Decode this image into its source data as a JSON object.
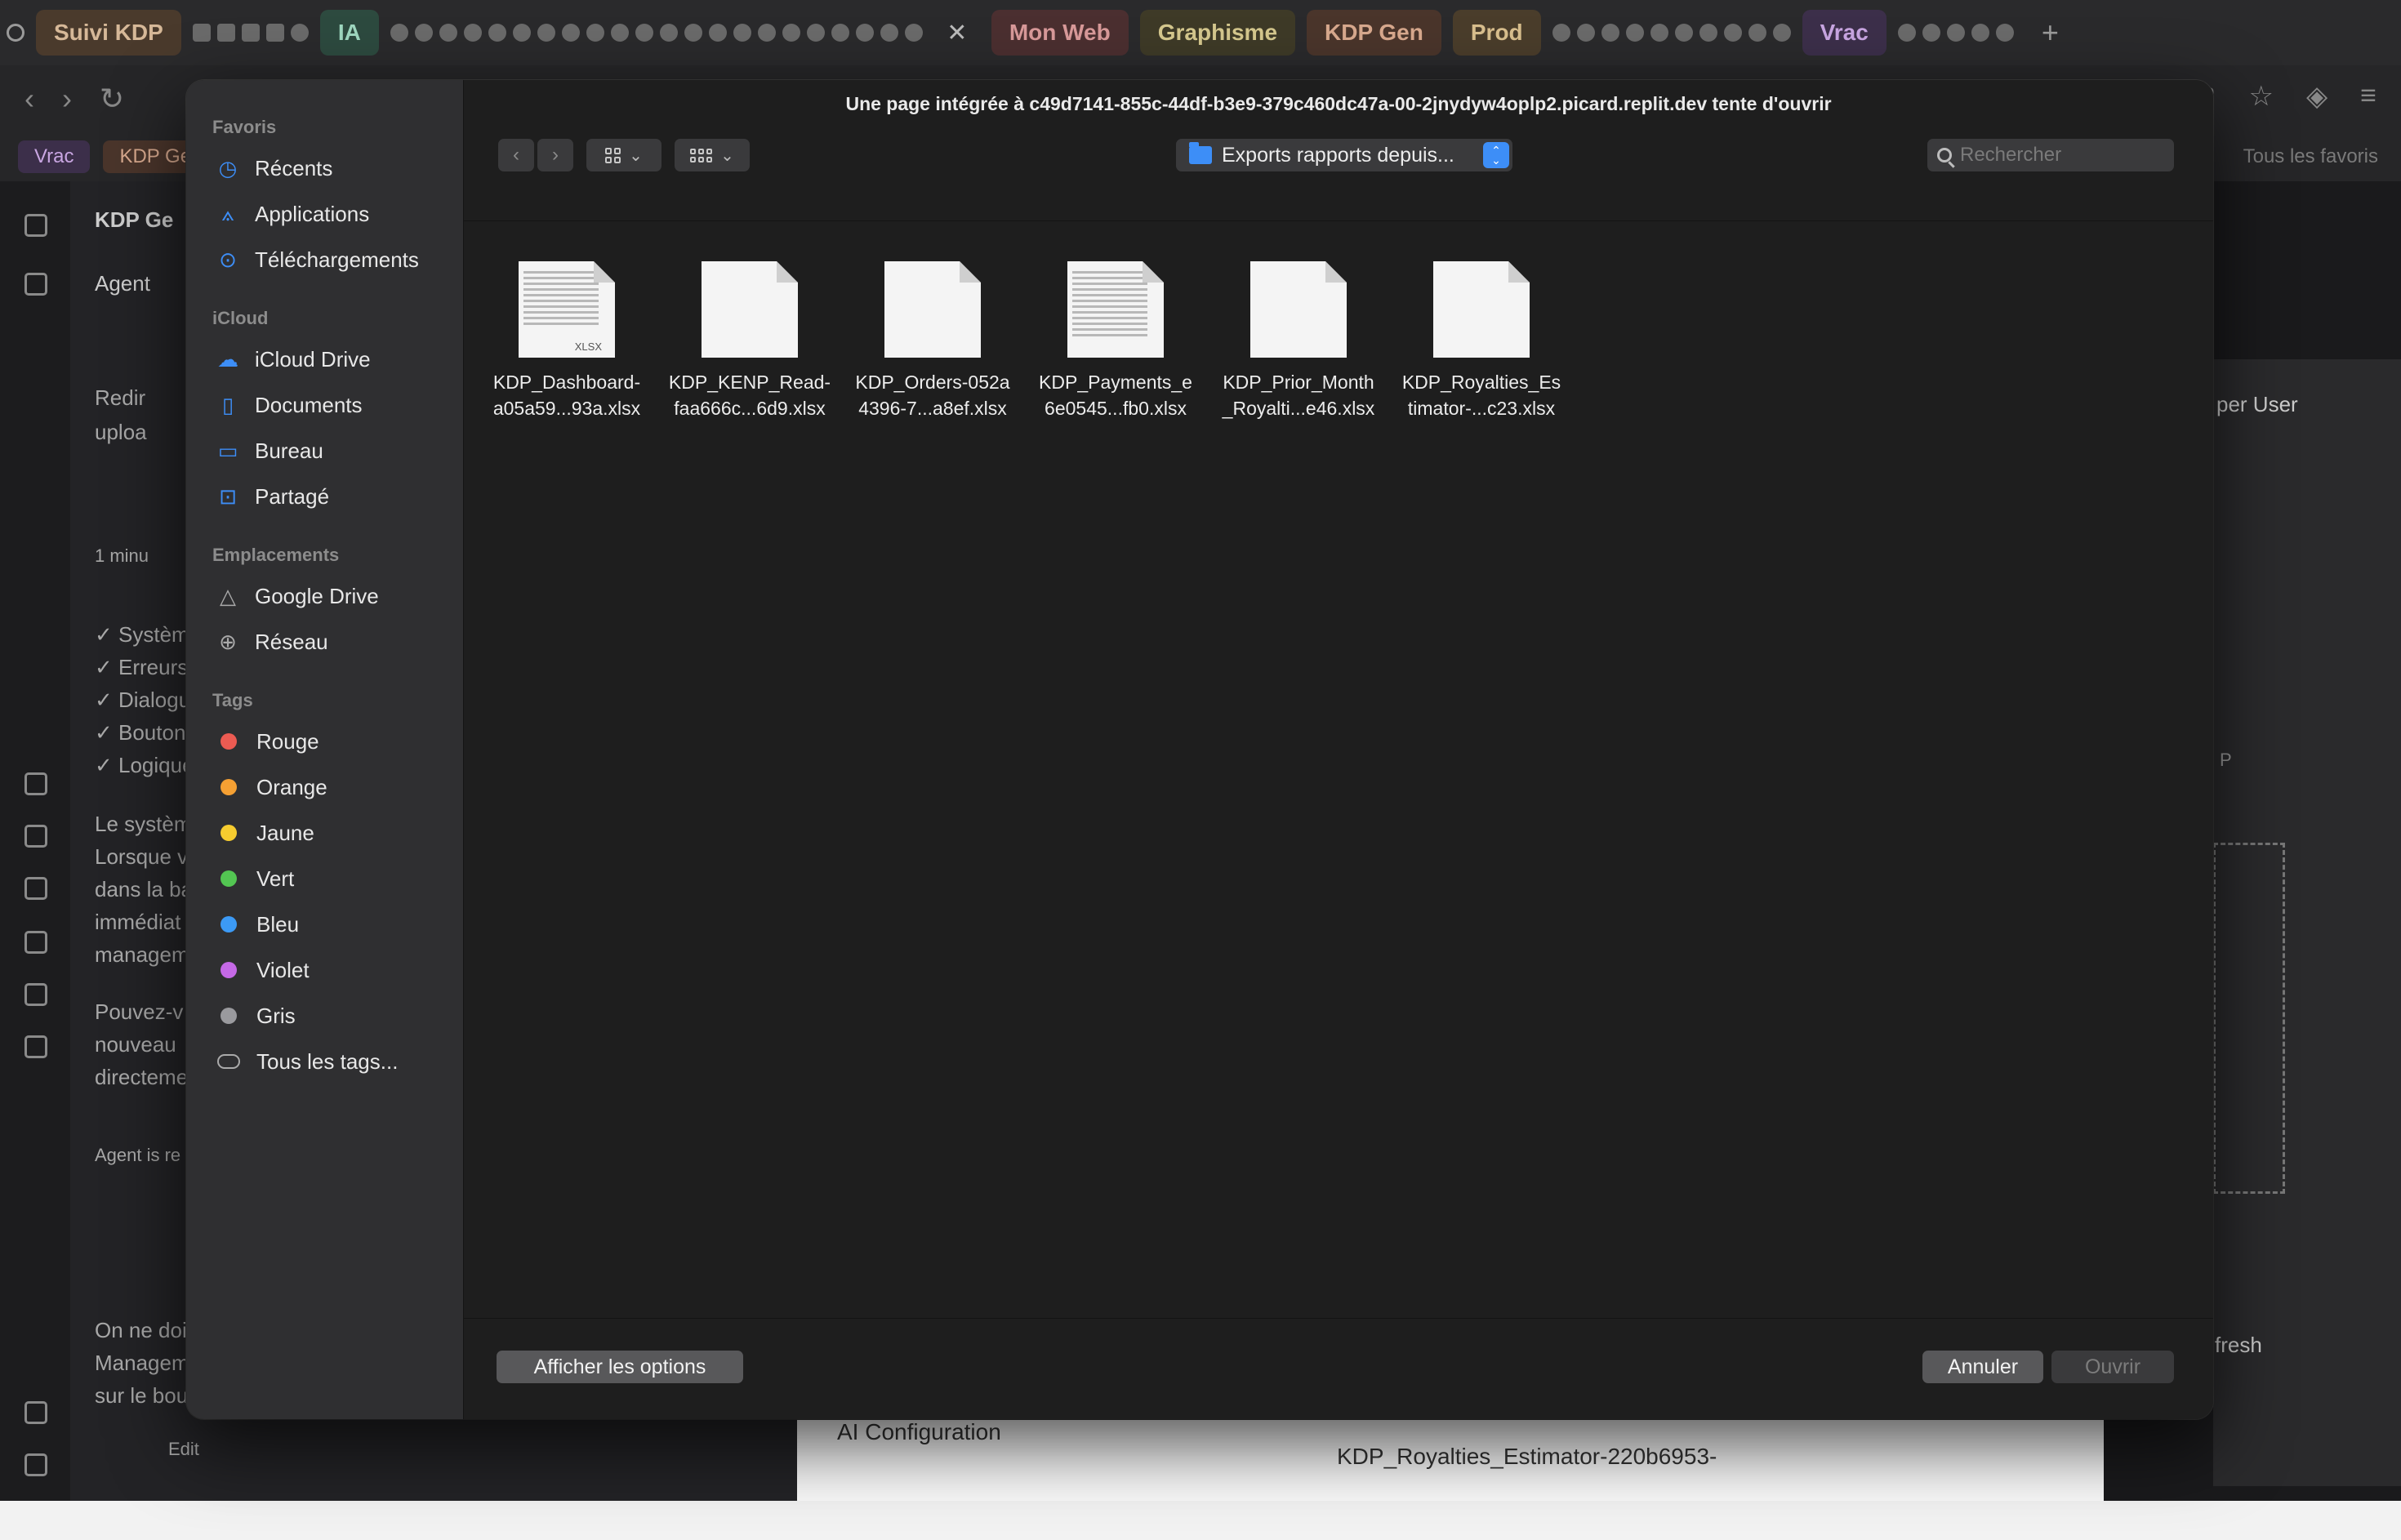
{
  "browser": {
    "tab_groups": [
      {
        "label": "Suivi KDP"
      },
      {
        "label": "IA"
      },
      {
        "label": "Mon Web"
      },
      {
        "label": "Graphisme"
      },
      {
        "label": "KDP Gen"
      },
      {
        "label": "Prod"
      },
      {
        "label": "Vrac"
      }
    ],
    "bookmarks": [
      {
        "label": "Vrac"
      },
      {
        "label": "KDP Ge"
      }
    ],
    "bookmarks_right": "Tous les favoris"
  },
  "background_app": {
    "project_title": "KDP Ge",
    "agent_tab": "Agent",
    "left_lines": [
      "Redir",
      "uploa",
      "1 minu",
      "✓ Systèm",
      "✓ Erreurs",
      "✓ Dialogu",
      "✓ Bouton",
      "✓ Logique",
      "Le systèm",
      "Lorsque v",
      "dans la ba",
      "immédiat",
      "managem",
      "Pouvez-v",
      "nouveau",
      "directeme",
      "Agent is re",
      "On ne doi",
      "Managem",
      "sur le bou"
    ],
    "edit_label": "Edit",
    "user_select": "per User",
    "right_hint": "P",
    "refresh_label": "fresh",
    "ai_config_label": "AI Configuration",
    "royalties_label": "KDP_Royalties_Estimator-220b6953-"
  },
  "dialog": {
    "title": "Une page intégrée à c49d7141-855c-44df-b3e9-379c460dc47a-00-2jnydyw4oplp2.picard.replit.dev tente d'ouvrir",
    "location": "Exports rapports depuis...",
    "search_placeholder": "Rechercher",
    "sidebar": {
      "favoris_title": "Favoris",
      "favoris": [
        {
          "label": "Récents",
          "icon": "clock-icon"
        },
        {
          "label": "Applications",
          "icon": "applications-icon"
        },
        {
          "label": "Téléchargements",
          "icon": "download-icon"
        }
      ],
      "icloud_title": "iCloud",
      "icloud": [
        {
          "label": "iCloud Drive",
          "icon": "cloud-icon"
        },
        {
          "label": "Documents",
          "icon": "document-icon"
        },
        {
          "label": "Bureau",
          "icon": "desktop-icon"
        },
        {
          "label": "Partagé",
          "icon": "shared-folder-icon"
        }
      ],
      "emplacements_title": "Emplacements",
      "emplacements": [
        {
          "label": "Google Drive",
          "icon": "drive-icon"
        },
        {
          "label": "Réseau",
          "icon": "network-icon"
        }
      ],
      "tags_title": "Tags",
      "tags": [
        {
          "label": "Rouge",
          "color": "#ec5b52"
        },
        {
          "label": "Orange",
          "color": "#f5a033"
        },
        {
          "label": "Jaune",
          "color": "#f6cc2f"
        },
        {
          "label": "Vert",
          "color": "#53c652"
        },
        {
          "label": "Bleu",
          "color": "#3c9af5"
        },
        {
          "label": "Violet",
          "color": "#c569e6"
        },
        {
          "label": "Gris",
          "color": "#9a9a9e"
        }
      ],
      "all_tags": "Tous les tags..."
    },
    "files": [
      {
        "line1": "KDP_Dashboard-",
        "line2": "a05a59...93a.xlsx",
        "thumb": "preview"
      },
      {
        "line1": "KDP_KENP_Read-",
        "line2": "faa666c...6d9.xlsx",
        "thumb": "blank"
      },
      {
        "line1": "KDP_Orders-052a",
        "line2": "4396-7...a8ef.xlsx",
        "thumb": "blank"
      },
      {
        "line1": "KDP_Payments_e",
        "line2": "6e0545...fb0.xlsx",
        "thumb": "sheet"
      },
      {
        "line1": "KDP_Prior_Month",
        "line2": "_Royalti...e46.xlsx",
        "thumb": "blank"
      },
      {
        "line1": "KDP_Royalties_Es",
        "line2": "timator-...c23.xlsx",
        "thumb": "blank"
      }
    ],
    "buttons": {
      "options": "Afficher les options",
      "cancel": "Annuler",
      "open": "Ouvrir"
    }
  }
}
